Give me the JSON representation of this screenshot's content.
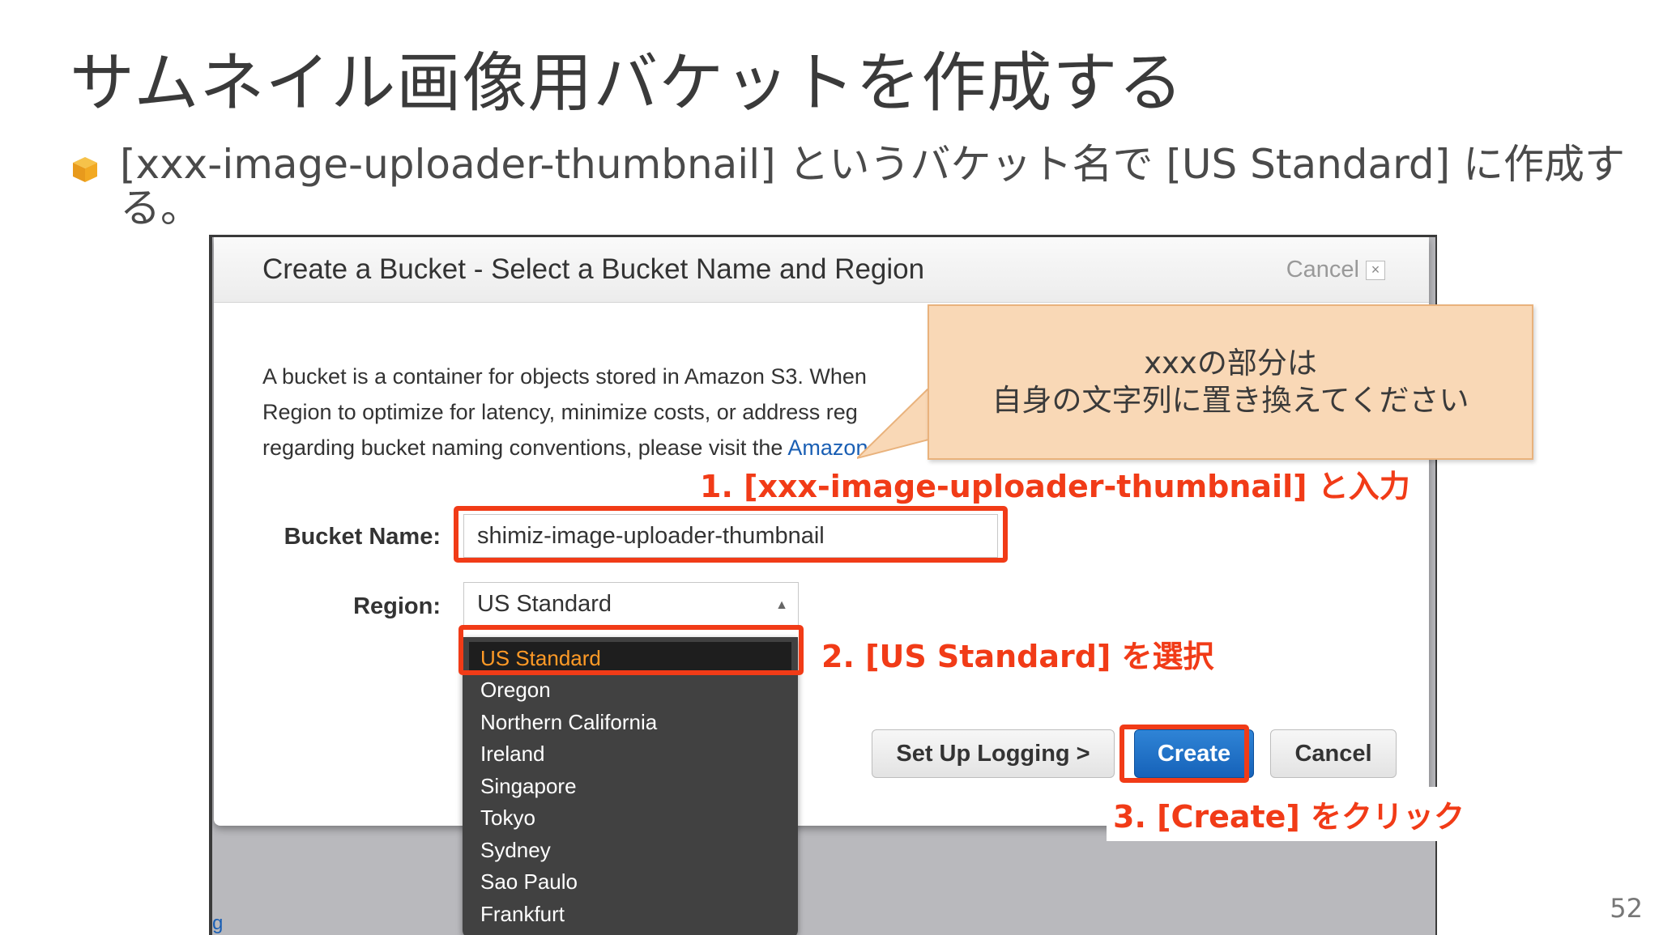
{
  "slide": {
    "title": "サムネイル画像用バケットを作成する",
    "bullet": "[xxx-image-uploader-thumbnail] というバケット名で [US Standard] に作成する。",
    "page_number": "52"
  },
  "dialog": {
    "title": "Create a Bucket - Select a Bucket Name and Region",
    "cancel_link": "Cancel",
    "description_lines": [
      "A bucket is a container for objects stored in Amazon S3. When",
      "Region to optimize for latency, minimize costs, or address reg",
      "regarding bucket naming conventions, please visit the "
    ],
    "description_link": "Amazon",
    "bucket_name_label": "Bucket Name:",
    "bucket_name_value": "shimiz-image-uploader-thumbnail",
    "region_label": "Region:",
    "region_selected": "US Standard",
    "region_options": [
      "US Standard",
      "Oregon",
      "Northern California",
      "Ireland",
      "Singapore",
      "Tokyo",
      "Sydney",
      "Sao Paulo",
      "Frankfurt"
    ],
    "buttons": {
      "setup_logging": "Set Up Logging >",
      "create": "Create",
      "cancel": "Cancel"
    }
  },
  "background_link": "g",
  "annotations": {
    "callout_line1": "xxxの部分は",
    "callout_line2": "自身の文字列に置き換えてください",
    "step1": "1. [xxx-image-uploader-thumbnail] と入力",
    "step2": "2. [US Standard] を選択",
    "step3": "3. [Create] をクリック"
  },
  "colors": {
    "highlight_red": "#f13b17",
    "callout_fill": "#f9d8b6",
    "primary_button": "#1662b9",
    "selected_option_text": "#ff9a26",
    "bullet_icon": "#f2a922"
  }
}
